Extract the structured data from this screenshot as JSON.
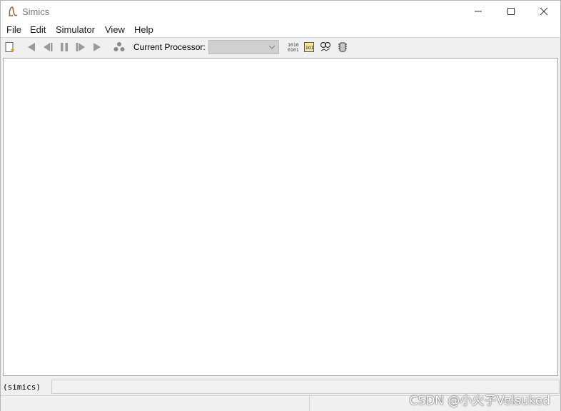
{
  "window": {
    "title": "Simics"
  },
  "menu": {
    "items": [
      "File",
      "Edit",
      "Simulator",
      "View",
      "Help"
    ]
  },
  "toolbar": {
    "processor_label": "Current Processor:",
    "processor_value": ""
  },
  "command": {
    "prompt": "(simics)",
    "value": ""
  },
  "watermark": "CSDN @小火子Velsuked",
  "icons": {
    "new": "new-window-icon",
    "rewind": "reverse-icon",
    "step_back": "step-back-icon",
    "pause": "pause-icon",
    "step_forward": "step-forward-icon",
    "run": "run-icon",
    "objects": "objects-icon",
    "binary": "binary-icon",
    "io": "io-icon",
    "stats": "stats-icon",
    "cpu": "cpu-icon"
  }
}
